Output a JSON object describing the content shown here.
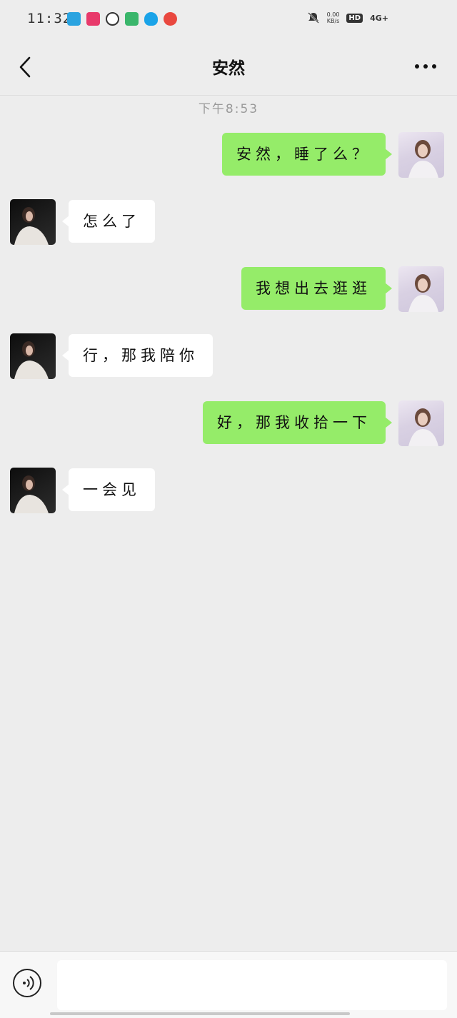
{
  "status_bar": {
    "time": "11:32",
    "speed_value": "0.00",
    "speed_unit": "KB/s",
    "hd_label": "HD",
    "network": "4G+"
  },
  "header": {
    "title": "安然"
  },
  "chat": {
    "timestamp": "下午8:53",
    "messages": [
      {
        "sender": "me",
        "text": "安然，睡了么？"
      },
      {
        "sender": "other",
        "text": "怎么了"
      },
      {
        "sender": "me",
        "text": "我想出去逛逛"
      },
      {
        "sender": "other",
        "text": "行，那我陪你"
      },
      {
        "sender": "me",
        "text": "好，那我收拾一下"
      },
      {
        "sender": "other",
        "text": "一会见"
      }
    ]
  },
  "colors": {
    "background": "#ededed",
    "my_bubble": "#95ec69",
    "other_bubble": "#ffffff",
    "timestamp_text": "#9a9a9a"
  },
  "icons": {
    "back": "chevron-left-icon",
    "more": "more-dots-icon",
    "voice": "voice-input-icon"
  },
  "input_bar": {
    "value": "",
    "placeholder": ""
  }
}
